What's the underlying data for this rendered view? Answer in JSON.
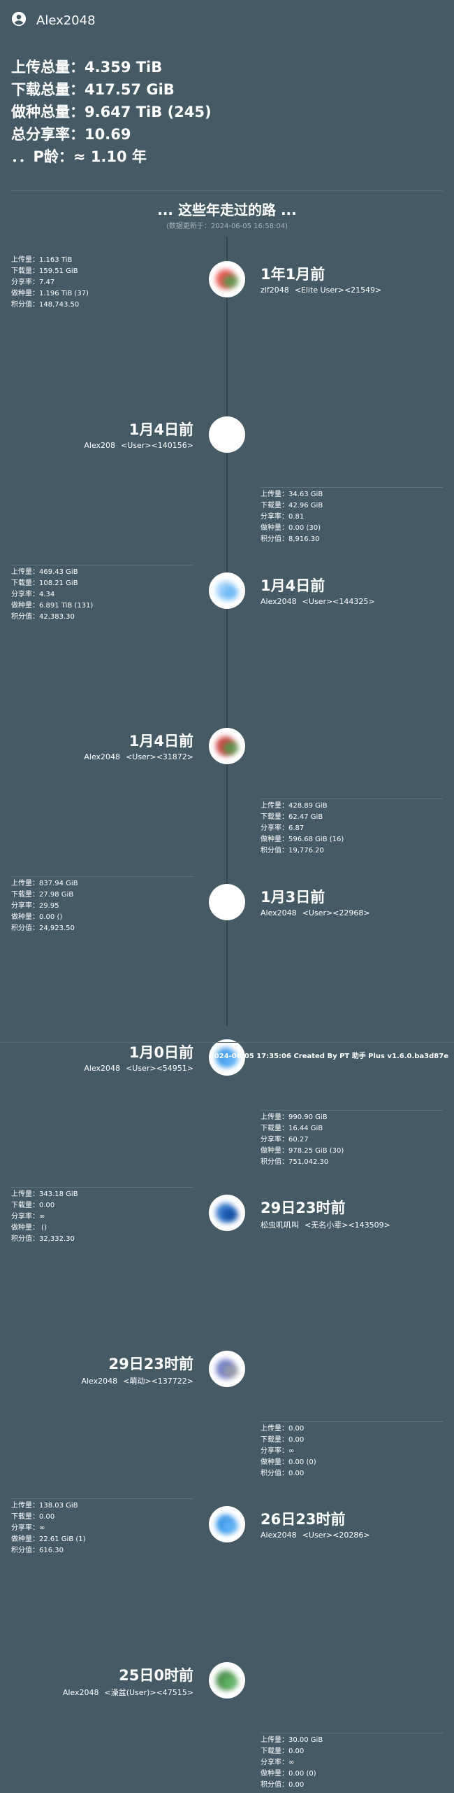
{
  "user": {
    "name": "Alex2048",
    "icon": "account-circle-icon"
  },
  "summary": [
    {
      "label": "上传总量：",
      "value": "4.359 TiB"
    },
    {
      "label": "下载总量：",
      "value": "417.57 GiB"
    },
    {
      "label": "做种总量：",
      "value": "9.647 TiB (245)"
    },
    {
      "label": "总分享率：",
      "value": "10.69"
    },
    {
      "label": "．．P龄：",
      "value": "≈ 1.10 年"
    }
  ],
  "timeline": {
    "title": "... 这些年走过的路 ...",
    "updated": "(数据更新于：2024-06-05 16:58:04)"
  },
  "stat_labels": {
    "upload": "上传量：",
    "download": "下载量：",
    "ratio": "分享率：",
    "seeding": "做种量：",
    "points": "积分值："
  },
  "sites": [
    {
      "time": "1年1月前",
      "username": "zlf2048",
      "user_class": "<Elite User><21549>",
      "upload": "1.163 TiB",
      "download": "159.51 GiB",
      "ratio": "7.47",
      "seeding": "1.196 TiB (37)",
      "points": "148,743.50",
      "icon_color": "#e53935",
      "accent": "#43a047"
    },
    {
      "time": "1月4日前",
      "username": "Alex208",
      "user_class": "<User><140156>",
      "upload": "34.63 GiB",
      "download": "42.96 GiB",
      "ratio": "0.81",
      "seeding": "0.00 (30)",
      "points": "8,916.30",
      "icon_color": "#ffffff",
      "accent": "#ffffff"
    },
    {
      "time": "1月4日前",
      "username": "Alex2048",
      "user_class": "<User><144325>",
      "upload": "469.43 GiB",
      "download": "108.21 GiB",
      "ratio": "4.34",
      "seeding": "6.891 TiB (131)",
      "points": "42,383.30",
      "icon_color": "#90caf9",
      "accent": "#64b5f6"
    },
    {
      "time": "1月4日前",
      "username": "Alex2048",
      "user_class": "<User><31872>",
      "upload": "428.89 GiB",
      "download": "62.47 GiB",
      "ratio": "6.87",
      "seeding": "596.68 GiB (16)",
      "points": "19,776.20",
      "icon_color": "#c62828",
      "accent": "#43a047"
    },
    {
      "time": "1月3日前",
      "username": "Alex2048",
      "user_class": "<User><22968>",
      "upload": "837.94 GiB",
      "download": "27.98 GiB",
      "ratio": "29.95",
      "seeding": "0.00 ()",
      "points": "24,923.50",
      "icon_color": "#ffffff",
      "accent": "#ffffff"
    },
    {
      "time": "1月0日前",
      "username": "Alex2048",
      "user_class": "<User><54951>",
      "upload": "990.90 GiB",
      "download": "16.44 GiB",
      "ratio": "60.27",
      "seeding": "978.25 GiB (30)",
      "points": "751,042.30",
      "icon_color": "#1e88e5",
      "accent": "#64b5f6"
    },
    {
      "time": "29日23时前",
      "username": "松虫叽叽叫",
      "user_class": "<无名小辈><143509>",
      "upload": "343.18 GiB",
      "download": "0.00",
      "ratio": "∞",
      "seeding": " ()",
      "points": "32,332.30",
      "icon_color": "#1565c0",
      "accent": "#0d47a1"
    },
    {
      "time": "29日23时前",
      "username": "Alex2048",
      "user_class": "<萌动><137722>",
      "upload": "0.00",
      "download": "0.00",
      "ratio": "∞",
      "seeding": "0.00 (0)",
      "points": "0.00",
      "icon_color": "#5c6bc0",
      "accent": "#9e9e9e"
    },
    {
      "time": "26日23时前",
      "username": "Alex2048",
      "user_class": "<User><20286>",
      "upload": "138.03 GiB",
      "download": "0.00",
      "ratio": "∞",
      "seeding": "22.61 GiB (1)",
      "points": "616.30",
      "icon_color": "#1e88e5",
      "accent": "#64b5f6"
    },
    {
      "time": "25日0时前",
      "username": "Alex2048",
      "user_class": "<澡盆(User)><47515>",
      "upload": "30.00 GiB",
      "download": "0.00",
      "ratio": "∞",
      "seeding": "0.00 (0)",
      "points": "0.00",
      "icon_color": "#2e7d32",
      "accent": "#66bb6a"
    }
  ],
  "footer": "2024-06-05 17:35:06 Created By PT 助手 Plus v1.6.0.ba3d87e"
}
